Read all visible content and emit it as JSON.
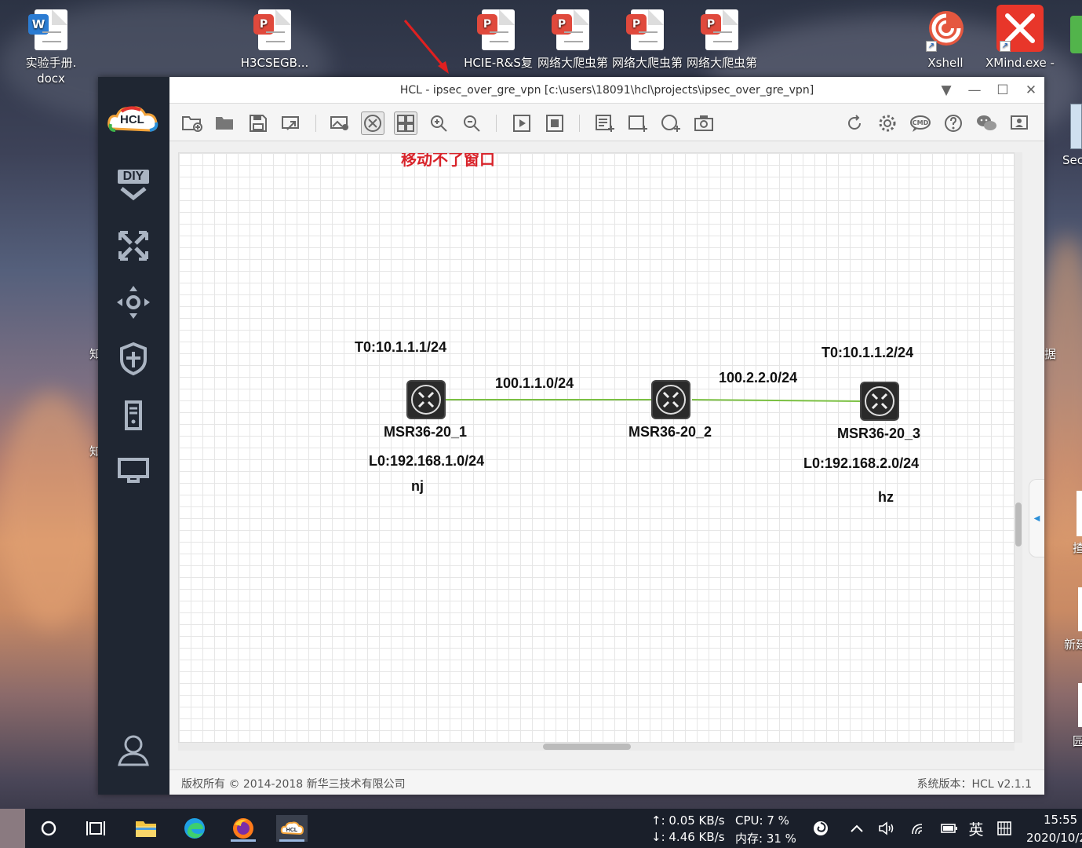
{
  "desktop": {
    "icons": [
      {
        "label": "实验手册.",
        "sub": "docx",
        "type": "word"
      },
      {
        "label": "H3CSEGB...",
        "sub": "",
        "type": "pdf"
      },
      {
        "label": "HCIE-R&S复",
        "sub": "",
        "type": "pdf"
      },
      {
        "label": "网络大爬虫第",
        "sub": "",
        "type": "pdf"
      },
      {
        "label": "网络大爬虫第",
        "sub": "",
        "type": "pdf"
      },
      {
        "label": "网络大爬虫第",
        "sub": "",
        "type": "pdf"
      },
      {
        "label": "Xshell",
        "sub": "",
        "type": "app"
      },
      {
        "label": "XMind.exe -",
        "sub": "",
        "type": "app"
      }
    ],
    "edge_labels": {
      "sec": "Sec",
      "ju": "据",
      "zhi1": "知",
      "zhi2": "知",
      "xin": "新建",
      "yuan": "园",
      "chi": "揸"
    }
  },
  "window": {
    "title": "HCL - ipsec_over_gre_vpn [c:\\users\\18091\\hcl\\projects\\ipsec_over_gre_vpn]",
    "logo_text": "HCL",
    "side_diy": "DIY",
    "annotation": "移动不了窗口",
    "status_left": "版权所有 © 2014-2018 新华三技术有限公司",
    "status_right": "系统版本：HCL v2.1.1"
  },
  "topology": {
    "devices": [
      {
        "name": "MSR36-20_1"
      },
      {
        "name": "MSR36-20_2"
      },
      {
        "name": "MSR36-20_3"
      }
    ],
    "labels": {
      "t0_left": "T0:10.1.1.1/24",
      "t0_right": "T0:10.1.1.2/24",
      "link1": "100.1.1.0/24",
      "link2": "100.2.2.0/24",
      "l0_left": "L0:192.168.1.0/24",
      "l0_right": "L0:192.168.2.0/24",
      "site_left": "nj",
      "site_right": "hz"
    },
    "link_color": "#7bc043"
  },
  "taskbar": {
    "net_up": "↑: 0.05 KB/s",
    "net_down": "↓: 4.46 KB/s",
    "cpu": "CPU: 7 %",
    "mem": "内存: 31 %",
    "ime": "英",
    "time": "15:55",
    "date": "2020/10/2"
  }
}
